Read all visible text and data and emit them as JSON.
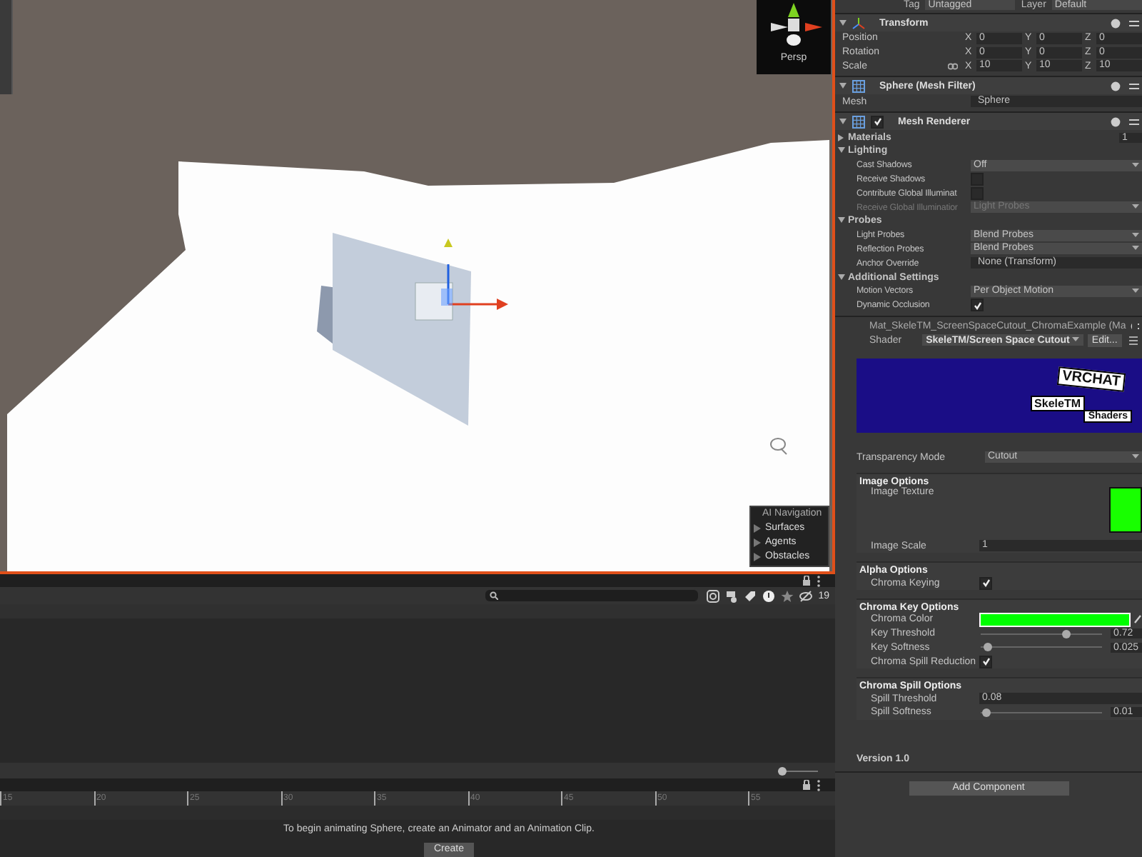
{
  "scene": {
    "view_mode": "Persp",
    "nav_overlay": {
      "title": "AI Navigation",
      "items": [
        "Surfaces",
        "Agents",
        "Obstacles"
      ]
    }
  },
  "console": {
    "count": "19",
    "zoom": {
      "level": 0
    }
  },
  "timeline": {
    "ticks": [
      "15",
      "20",
      "25",
      "30",
      "35",
      "40",
      "45",
      "50",
      "55"
    ],
    "message": "To begin animating Sphere, create an Animator and an Animation Clip.",
    "button": "Create"
  },
  "inspector": {
    "header": {
      "tag_label": "Tag",
      "tag": "Untagged",
      "layer_label": "Layer",
      "layer": "Default"
    },
    "transform": {
      "title": "Transform",
      "rows": [
        {
          "label": "Position",
          "linked": false,
          "values": [
            {
              "axis": "X",
              "value": "0"
            },
            {
              "axis": "Y",
              "value": "0"
            },
            {
              "axis": "Z",
              "value": "0"
            }
          ]
        },
        {
          "label": "Rotation",
          "linked": false,
          "values": [
            {
              "axis": "X",
              "value": "0"
            },
            {
              "axis": "Y",
              "value": "0"
            },
            {
              "axis": "Z",
              "value": "0"
            }
          ]
        },
        {
          "label": "Scale",
          "linked": true,
          "values": [
            {
              "axis": "X",
              "value": "10"
            },
            {
              "axis": "Y",
              "value": "10"
            },
            {
              "axis": "Z",
              "value": "10"
            }
          ]
        }
      ]
    },
    "mesh_filter": {
      "title": "Sphere (Mesh Filter)",
      "label": "Mesh",
      "value": "Sphere"
    },
    "mesh_renderer": {
      "title": "Mesh Renderer",
      "enabled": true,
      "rows": [
        {
          "kind": "foldout",
          "label": "Materials",
          "expanded": false,
          "value": "1",
          "disabled": false
        },
        {
          "kind": "foldout",
          "label": "Lighting",
          "expanded": true,
          "disabled": false
        },
        {
          "kind": "dropdown",
          "label": "Cast Shadows",
          "value": "Off",
          "disabled": false
        },
        {
          "kind": "checkbox",
          "label": "Receive Shadows",
          "checked": false,
          "disabled": false
        },
        {
          "kind": "checkbox",
          "label": "Contribute Global Illuminat",
          "checked": false,
          "disabled": false
        },
        {
          "kind": "dropdown",
          "label": "Receive Global Illuminatior",
          "value": "Light Probes",
          "disabled": true
        },
        {
          "kind": "foldout",
          "label": "Probes",
          "expanded": true,
          "disabled": false
        },
        {
          "kind": "dropdown",
          "label": "Light Probes",
          "value": "Blend Probes",
          "disabled": false
        },
        {
          "kind": "dropdown",
          "label": "Reflection Probes",
          "value": "Blend Probes",
          "disabled": false
        },
        {
          "kind": "object",
          "label": "Anchor Override",
          "value": "None (Transform)",
          "disabled": false
        },
        {
          "kind": "foldout",
          "label": "Additional Settings",
          "expanded": true,
          "disabled": false
        },
        {
          "kind": "dropdown",
          "label": "Motion Vectors",
          "value": "Per Object Motion",
          "disabled": false
        },
        {
          "kind": "checkbox",
          "label": "Dynamic Occlusion",
          "checked": true,
          "disabled": false
        }
      ]
    },
    "material": {
      "title": "Mat_SkeleTM_ScreenSpaceCutout_ChromaExample (Ma",
      "shader_label": "Shader",
      "shader": "SkeleTM/Screen Space Cutout",
      "edit": "Edit...",
      "banner": {
        "line_1": "VRCHAT",
        "line_2": "SkeleTM",
        "line_3": "Shaders"
      },
      "transparency": {
        "label": "Transparency Mode",
        "value": "Cutout"
      },
      "groups": [
        {
          "title": "Image Options",
          "rows": [
            {
              "kind": "texture",
              "label": "Image Texture"
            },
            {
              "kind": "field",
              "label": "Image Scale",
              "value": "1"
            }
          ]
        },
        {
          "title": "Alpha Options",
          "rows": [
            {
              "kind": "checkbox",
              "label": "Chroma Keying",
              "checked": true
            }
          ]
        },
        {
          "title": "Chroma Key Options",
          "rows": [
            {
              "kind": "color",
              "label": "Chroma Color",
              "color": "#00ff00"
            },
            {
              "kind": "slider",
              "label": "Key Threshold",
              "level": 0.72,
              "value": "0.72"
            },
            {
              "kind": "slider",
              "label": "Key Softness",
              "level": 0.025,
              "value": "0.025"
            },
            {
              "kind": "checkbox",
              "label": "Chroma Spill Reduction",
              "checked": true
            }
          ]
        },
        {
          "title": "Chroma Spill Options",
          "rows": [
            {
              "kind": "field",
              "label": "Spill Threshold",
              "value": "0.08"
            },
            {
              "kind": "slider",
              "label": "Spill Softness",
              "level": 0.01,
              "value": "0.01"
            }
          ]
        }
      ],
      "version": "Version 1.0"
    },
    "add_component": "Add Component"
  }
}
